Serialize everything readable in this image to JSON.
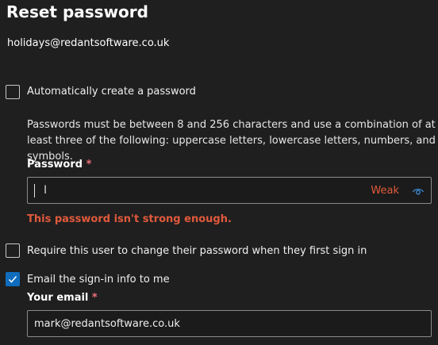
{
  "page": {
    "title": "Reset password",
    "user_email": "holidays@redantsoftware.co.uk"
  },
  "auto_create": {
    "label": "Automatically create a password",
    "checked": false
  },
  "password_help": "Passwords must be between 8 and 256 characters and use a combination of at least three of the following: uppercase letters, lowercase letters, numbers, and symbols.",
  "password_field": {
    "label": "Password",
    "required_mark": "*",
    "value": "",
    "strength": "Weak",
    "strength_color": "#e05a3a",
    "reveal_icon": "eye-icon",
    "error": "This password isn't strong enough."
  },
  "require_change": {
    "label": "Require this user to change their password when they first sign in",
    "checked": false
  },
  "email_signin": {
    "label": "Email the sign-in info to me",
    "checked": true
  },
  "your_email": {
    "label": "Your email",
    "required_mark": "*",
    "value": "mark@redantsoftware.co.uk"
  },
  "colors": {
    "background": "#1f1f1f",
    "accent": "#0f6cbd",
    "error": "#e0593c",
    "required": "#f1707b"
  }
}
